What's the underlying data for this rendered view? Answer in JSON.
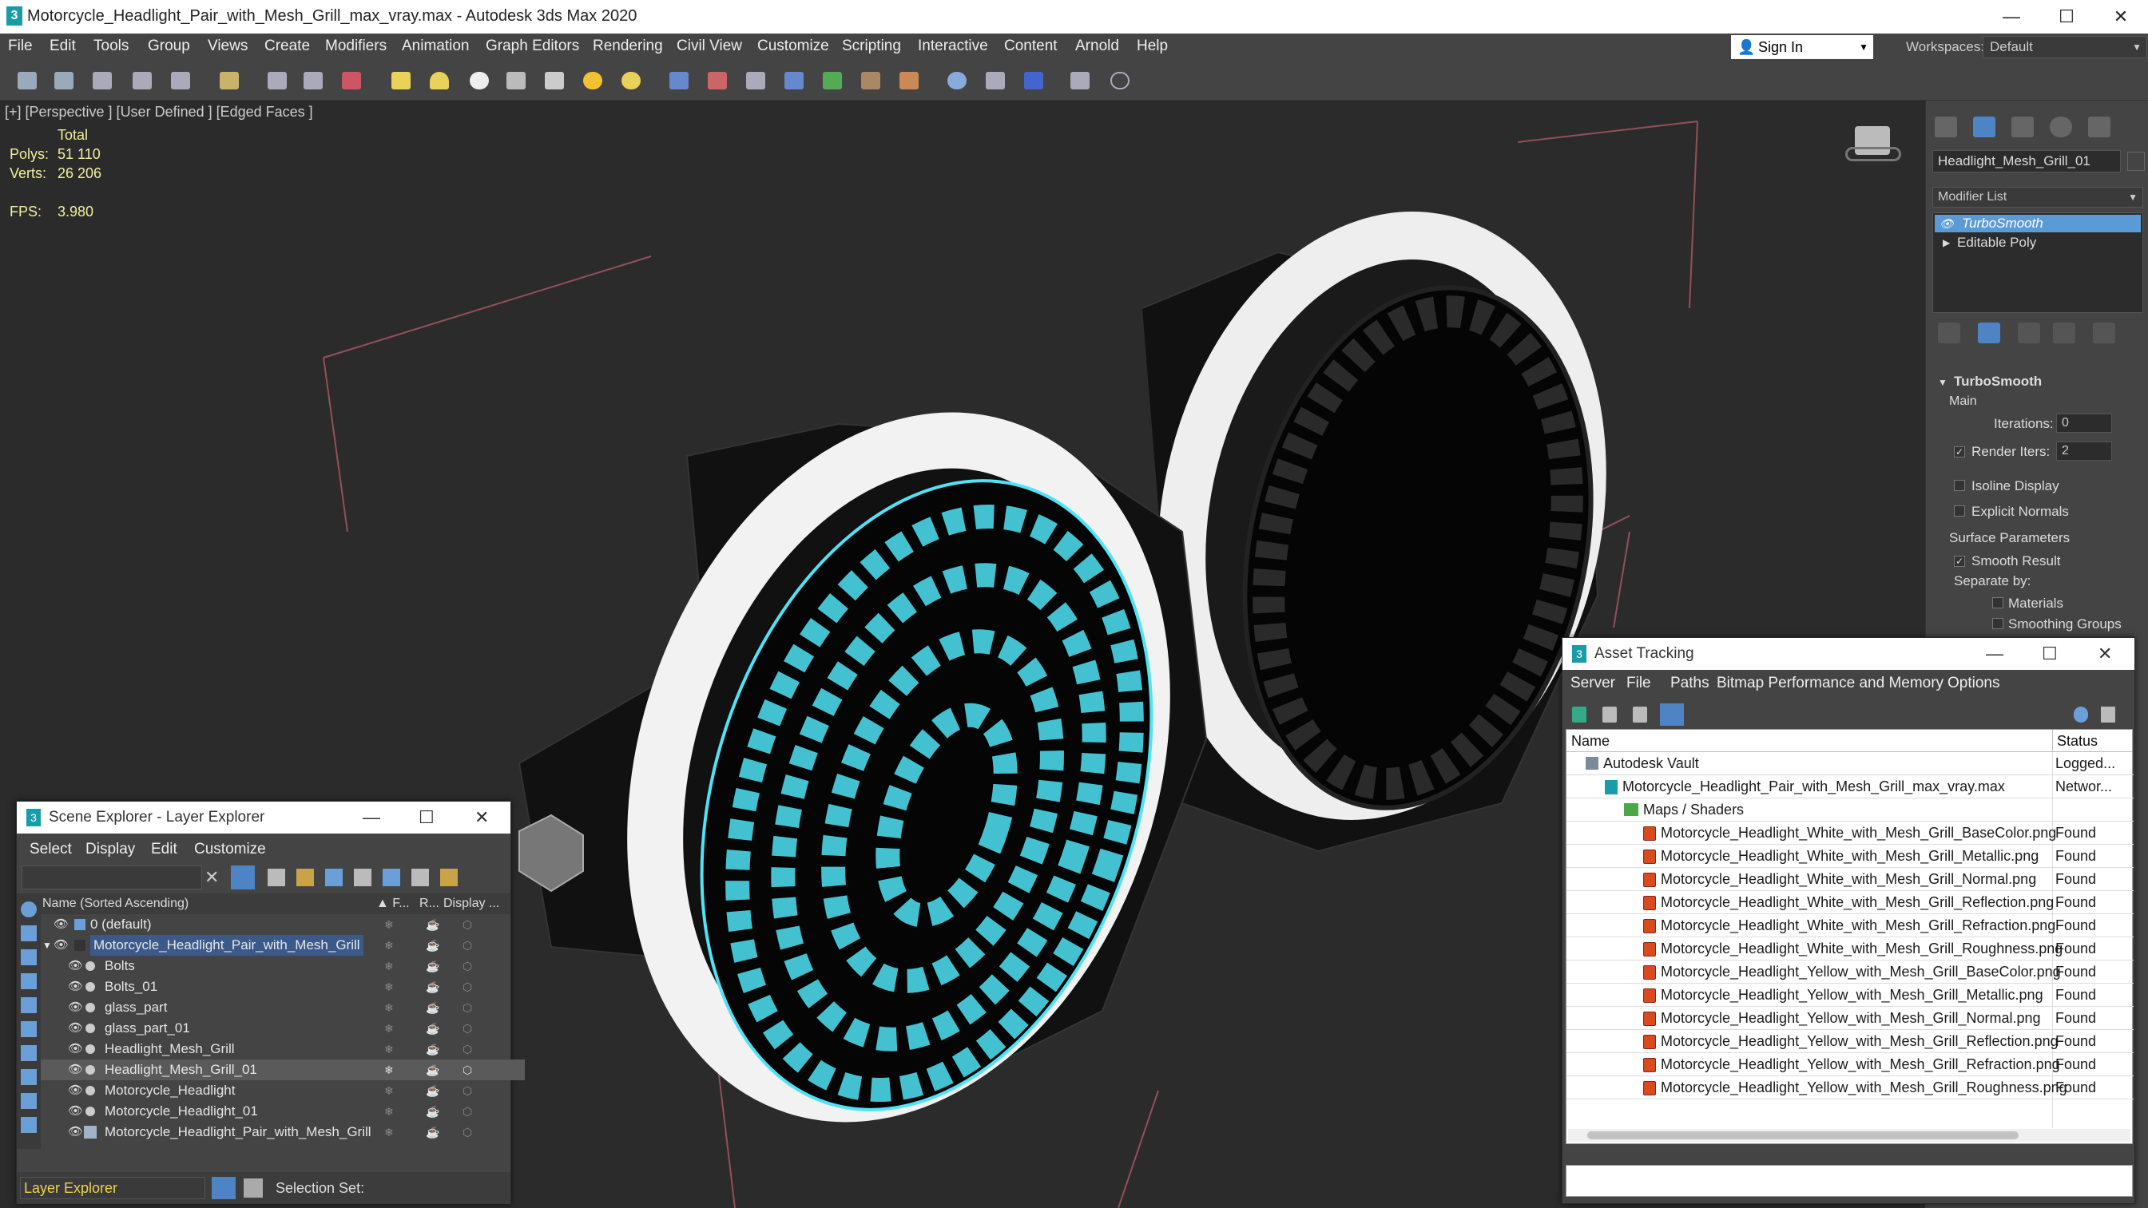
{
  "window": {
    "title": "Motorcycle_Headlight_Pair_with_Mesh_Grill_max_vray.max - Autodesk 3ds Max 2020"
  },
  "menu": [
    "File",
    "Edit",
    "Tools",
    "Group",
    "Views",
    "Create",
    "Modifiers",
    "Animation",
    "Graph Editors",
    "Rendering",
    "Civil View",
    "Customize",
    "Scripting",
    "Interactive",
    "Content",
    "Arnold",
    "Help"
  ],
  "account": {
    "sign_in": "Sign In",
    "workspaces_label": "Workspaces:",
    "workspace": "Default"
  },
  "viewport": {
    "label": "[+] [Perspective ] [User Defined ] [Edged Faces ]",
    "stats": {
      "total_label": "Total",
      "polys_label": "Polys:",
      "polys": "51 110",
      "verts_label": "Verts:",
      "verts": "26 206",
      "fps_label": "FPS:",
      "fps": "3.980"
    }
  },
  "command_panel": {
    "object_name": "Headlight_Mesh_Grill_01",
    "modifier_list": "Modifier List",
    "stack": [
      "TurboSmooth",
      "Editable Poly"
    ],
    "rollout_title": "TurboSmooth",
    "main_label": "Main",
    "iterations_label": "Iterations:",
    "iterations": "0",
    "render_iters_label": "Render Iters:",
    "render_iters": "2",
    "isoline": "Isoline Display",
    "explicit_normals": "Explicit Normals",
    "surface_params": "Surface Parameters",
    "smooth_result": "Smooth Result",
    "separate_by": "Separate by:",
    "materials": "Materials",
    "smoothing_groups": "Smoothing Groups"
  },
  "scene_explorer": {
    "title": "Scene Explorer - Layer Explorer",
    "menu": [
      "Select",
      "Display",
      "Edit",
      "Customize"
    ],
    "columns": {
      "name": "Name (Sorted Ascending)",
      "frozen": "▲ F...",
      "render": "R...",
      "display": "Display ..."
    },
    "rows": [
      {
        "name": "0 (default)",
        "level": 1,
        "type": "layer"
      },
      {
        "name": "Motorcycle_Headlight_Pair_with_Mesh_Grill",
        "level": 1,
        "type": "layer",
        "highlight": true
      },
      {
        "name": "Bolts",
        "level": 2,
        "type": "object"
      },
      {
        "name": "Bolts_01",
        "level": 2,
        "type": "object"
      },
      {
        "name": "glass_part",
        "level": 2,
        "type": "object"
      },
      {
        "name": "glass_part_01",
        "level": 2,
        "type": "object"
      },
      {
        "name": "Headlight_Mesh_Grill",
        "level": 2,
        "type": "object"
      },
      {
        "name": "Headlight_Mesh_Grill_01",
        "level": 2,
        "type": "object",
        "selected": true
      },
      {
        "name": "Motorcycle_Headlight",
        "level": 2,
        "type": "object"
      },
      {
        "name": "Motorcycle_Headlight_01",
        "level": 2,
        "type": "object"
      },
      {
        "name": "Motorcycle_Headlight_Pair_with_Mesh_Grill",
        "level": 2,
        "type": "group"
      }
    ],
    "footer_explorer": "Layer Explorer",
    "selection_set_label": "Selection Set:"
  },
  "asset_tracking": {
    "title": "Asset Tracking",
    "menu": [
      "Server",
      "File",
      "Paths",
      "Bitmap Performance and Memory",
      "Options"
    ],
    "columns": {
      "name": "Name",
      "status": "Status"
    },
    "rows": [
      {
        "name": "Autodesk Vault",
        "status": "Logged...",
        "level": 0
      },
      {
        "name": "Motorcycle_Headlight_Pair_with_Mesh_Grill_max_vray.max",
        "status": "Networ...",
        "level": 1
      },
      {
        "name": "Maps / Shaders",
        "status": "",
        "level": 2
      },
      {
        "name": "Motorcycle_Headlight_White_with_Mesh_Grill_BaseColor.png",
        "status": "Found",
        "level": 3
      },
      {
        "name": "Motorcycle_Headlight_White_with_Mesh_Grill_Metallic.png",
        "status": "Found",
        "level": 3
      },
      {
        "name": "Motorcycle_Headlight_White_with_Mesh_Grill_Normal.png",
        "status": "Found",
        "level": 3
      },
      {
        "name": "Motorcycle_Headlight_White_with_Mesh_Grill_Reflection.png",
        "status": "Found",
        "level": 3
      },
      {
        "name": "Motorcycle_Headlight_White_with_Mesh_Grill_Refraction.png",
        "status": "Found",
        "level": 3
      },
      {
        "name": "Motorcycle_Headlight_White_with_Mesh_Grill_Roughness.png",
        "status": "Found",
        "level": 3
      },
      {
        "name": "Motorcycle_Headlight_Yellow_with_Mesh_Grill_BaseColor.png",
        "status": "Found",
        "level": 3
      },
      {
        "name": "Motorcycle_Headlight_Yellow_with_Mesh_Grill_Metallic.png",
        "status": "Found",
        "level": 3
      },
      {
        "name": "Motorcycle_Headlight_Yellow_with_Mesh_Grill_Normal.png",
        "status": "Found",
        "level": 3
      },
      {
        "name": "Motorcycle_Headlight_Yellow_with_Mesh_Grill_Reflection.png",
        "status": "Found",
        "level": 3
      },
      {
        "name": "Motorcycle_Headlight_Yellow_with_Mesh_Grill_Refraction.png",
        "status": "Found",
        "level": 3
      },
      {
        "name": "Motorcycle_Headlight_Yellow_with_Mesh_Grill_Roughness.png",
        "status": "Found",
        "level": 3
      }
    ]
  },
  "colors": {
    "accent": "#5b9bd5",
    "selection_wire": "#4fe3f5",
    "stats_text": "#f3ef9b",
    "viewport_bg": "#2b2b2b"
  }
}
